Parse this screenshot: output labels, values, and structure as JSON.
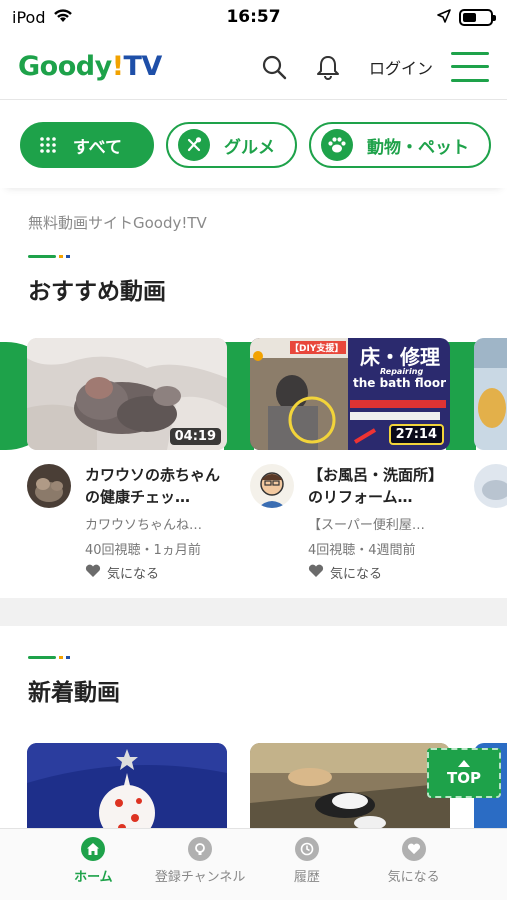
{
  "status_bar": {
    "carrier": "iPod",
    "time": "16:57"
  },
  "header": {
    "logo_main": "Goody",
    "logo_excl": "!",
    "logo_tv": "TV",
    "login_label": "ログイン"
  },
  "categories": [
    {
      "label": "すべて",
      "icon": "grid-icon"
    },
    {
      "label": "グルメ",
      "icon": "fork-spoon-icon"
    },
    {
      "label": "動物・ペット",
      "icon": "paw-icon"
    }
  ],
  "site_caption": "無料動画サイトGoody!TV",
  "recommended": {
    "title": "おすすめ動画",
    "videos": [
      {
        "title": "カワウソの赤ちゃんの健康チェッ…",
        "channel": "カワウソちゃんね…",
        "stats": "40回視聴・1ヵ月前",
        "like": "気になる",
        "duration": "04:19"
      },
      {
        "title": "【お風呂・洗面所】のリフォーム…",
        "channel": "【スーパー便利屋…",
        "stats": "4回視聴・4週間前",
        "like": "気になる",
        "duration": "27:14",
        "thumb_badge": "【DIY支援】",
        "thumb_heading": "床・修理",
        "thumb_sub1": "Repairing",
        "thumb_sub2": "the bath floor"
      }
    ]
  },
  "new_videos": {
    "title": "新着動画"
  },
  "top_button": "TOP",
  "bottom_nav": [
    {
      "label": "ホーム",
      "icon": "home-icon"
    },
    {
      "label": "登録チャンネル",
      "icon": "channel-icon"
    },
    {
      "label": "履歴",
      "icon": "history-clock-icon"
    },
    {
      "label": "気になる",
      "icon": "heart-icon"
    }
  ],
  "colors": {
    "brand_green": "#1ea24a",
    "accent_orange": "#f2a200",
    "accent_blue": "#1e4fa8"
  }
}
